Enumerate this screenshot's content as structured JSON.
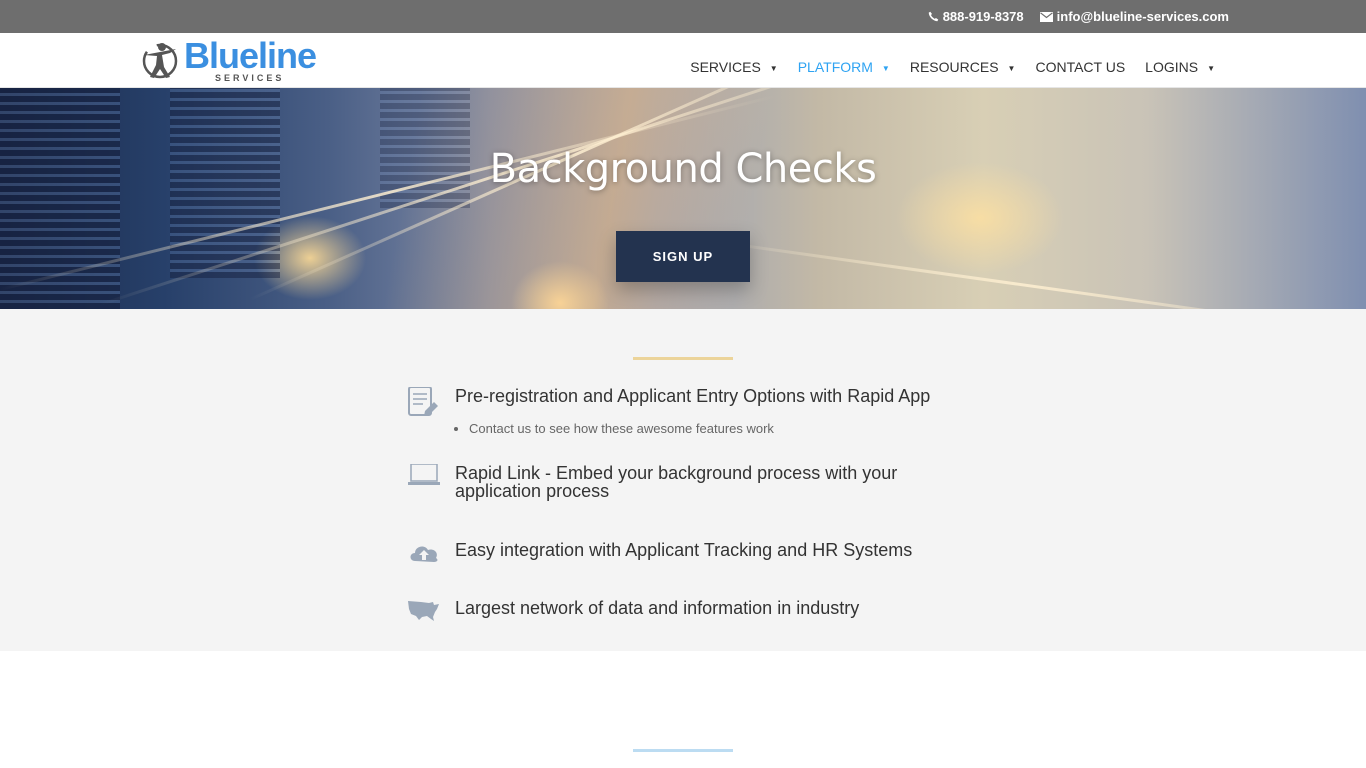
{
  "topbar": {
    "phone": "888-919-8378",
    "email": "info@blueline-services.com"
  },
  "logo": {
    "name": "Blueline",
    "tagline": "SERVICES"
  },
  "nav": {
    "items": [
      {
        "label": "SERVICES",
        "has_dropdown": true
      },
      {
        "label": "PLATFORM",
        "has_dropdown": true,
        "active": true
      },
      {
        "label": "RESOURCES",
        "has_dropdown": true
      },
      {
        "label": "CONTACT US",
        "has_dropdown": false
      },
      {
        "label": "LOGINS",
        "has_dropdown": true
      }
    ]
  },
  "hero": {
    "title": "Background Checks",
    "button": "SIGN UP"
  },
  "features": {
    "items": [
      {
        "icon": "tablet-pencil-icon",
        "text": "Pre-registration and Applicant Entry Options with Rapid App",
        "bullets": [
          "Contact us to see how these awesome features work"
        ]
      },
      {
        "icon": "laptop-icon",
        "text": "Rapid Link - Embed your background process with your application process"
      },
      {
        "icon": "cloud-upload-icon",
        "text": "Easy integration with Applicant Tracking and HR Systems"
      },
      {
        "icon": "usa-map-icon",
        "text": "Largest network of data and information in industry"
      }
    ]
  },
  "colors": {
    "topbar": "#6e6e6e",
    "brand_blue": "#3b8fe0",
    "nav_active": "#2ea3f2",
    "button": "#23334f",
    "divider_gold": "#ecd49a",
    "divider_blue": "#bcdcf2",
    "section_bg": "#f4f4f4"
  }
}
